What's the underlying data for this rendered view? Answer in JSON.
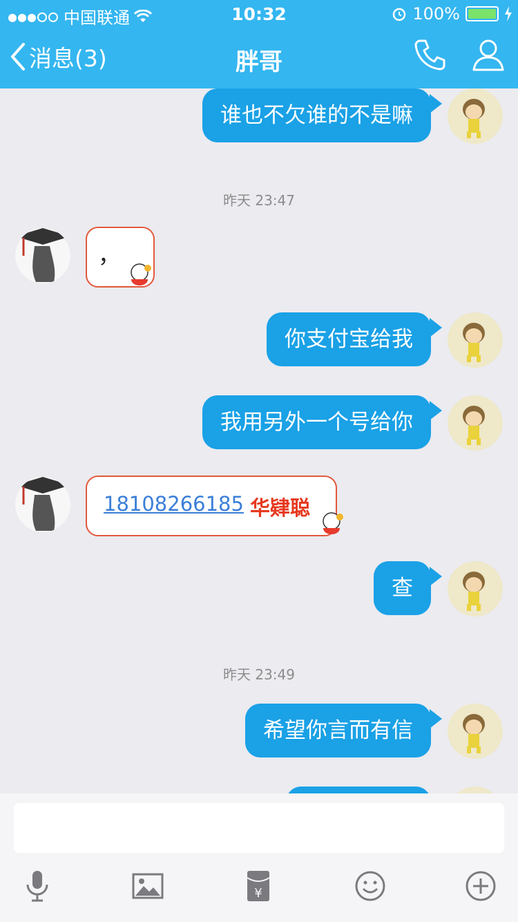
{
  "status": {
    "carrier": "中国联通",
    "time": "10:32",
    "battery": "100%"
  },
  "nav": {
    "back_label": "消息(3)",
    "title": "胖哥"
  },
  "messages": [
    {
      "side": "me",
      "text": "谁也不欠谁的不是嘛"
    },
    {
      "timestamp": "昨天 23:47"
    },
    {
      "side": "friend",
      "text": "，"
    },
    {
      "side": "me",
      "text": "你支付宝给我"
    },
    {
      "side": "me",
      "text": "我用另外一个号给你"
    },
    {
      "side": "friend",
      "phone": "18108266185",
      "name": "华肄聪"
    },
    {
      "side": "me",
      "text": "查"
    },
    {
      "timestamp": "昨天 23:49"
    },
    {
      "side": "me",
      "text": "希望你言而有信"
    }
  ],
  "colors": {
    "header": "#34b6f0",
    "bubble_me": "#1aa1e6",
    "friend_bubble_border": "#e2583a",
    "background": "#ebebf0"
  },
  "toolbar": [
    "microphone-icon",
    "image-icon",
    "red-packet-icon",
    "emoji-icon",
    "plus-icon"
  ]
}
